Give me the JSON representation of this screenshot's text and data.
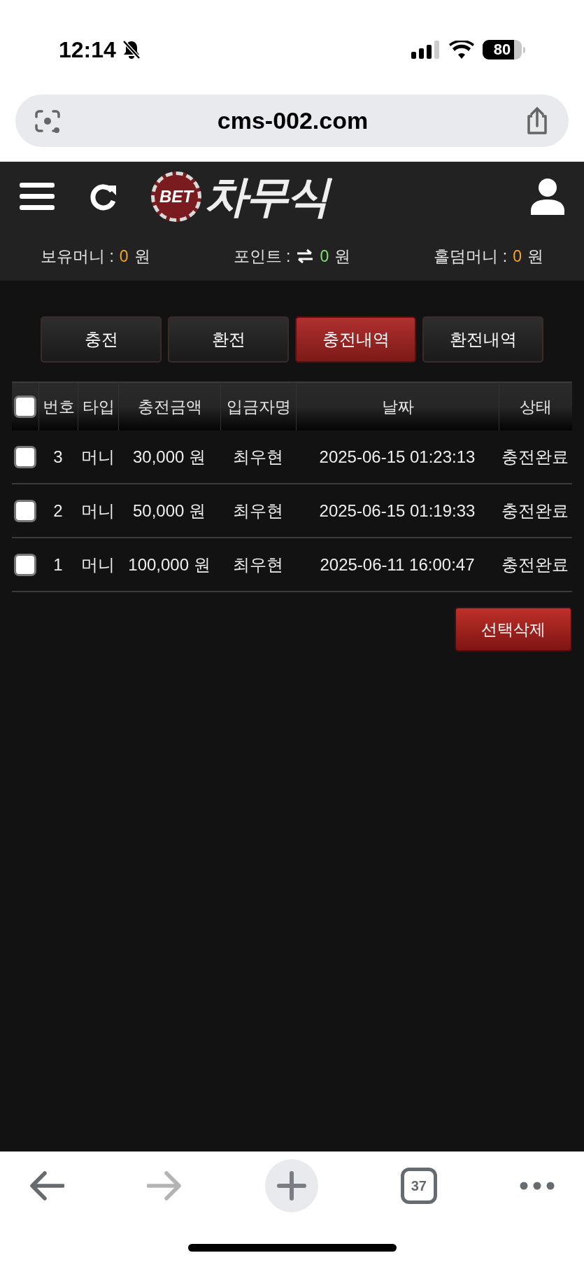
{
  "status_bar": {
    "time": "12:14",
    "battery": "80"
  },
  "browser": {
    "url": "cms-002.com",
    "tab_count": "37"
  },
  "header": {
    "logo_badge": "BET",
    "logo_text": "차무식"
  },
  "balances": [
    {
      "kind": "money",
      "label": "보유머니 :",
      "value": "0",
      "unit": "원",
      "color": "#f5a623"
    },
    {
      "kind": "points",
      "label": "포인트 :",
      "value": "0",
      "unit": "원",
      "color": "#7ee36a"
    },
    {
      "kind": "money",
      "label": "홀덤머니 :",
      "value": "0",
      "unit": "원",
      "color": "#f5a623"
    }
  ],
  "tabs": [
    {
      "label": "충전",
      "selected": false
    },
    {
      "label": "환전",
      "selected": false
    },
    {
      "label": "충전내역",
      "selected": true
    },
    {
      "label": "환전내역",
      "selected": false
    }
  ],
  "table": {
    "select_all_checked": false,
    "columns": [
      "번호",
      "타입",
      "충전금액",
      "입금자명",
      "날짜",
      "상태"
    ],
    "rows": [
      {
        "checked": false,
        "cells": [
          "3",
          "머니",
          "30,000 원",
          "최우현",
          "2025-06-15 01:23:13",
          "충전완료"
        ]
      },
      {
        "checked": false,
        "cells": [
          "2",
          "머니",
          "50,000 원",
          "최우현",
          "2025-06-15 01:19:33",
          "충전완료"
        ]
      },
      {
        "checked": false,
        "cells": [
          "1",
          "머니",
          "100,000 원",
          "최우현",
          "2025-06-11 16:00:47",
          "충전완료"
        ]
      }
    ]
  },
  "delete_button": "선택삭제"
}
